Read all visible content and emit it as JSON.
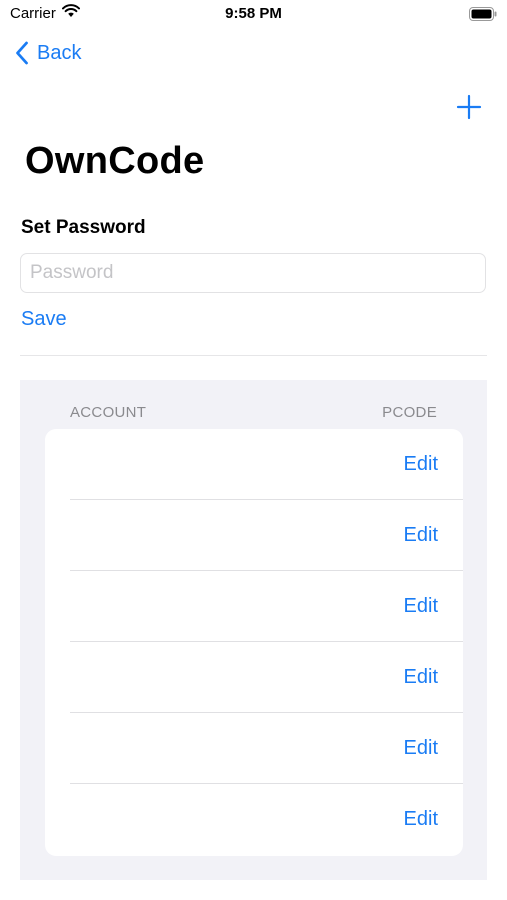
{
  "status_bar": {
    "carrier": "Carrier",
    "time": "9:58 PM"
  },
  "nav": {
    "back_label": "Back"
  },
  "page": {
    "title": "OwnCode"
  },
  "form": {
    "section_label": "Set Password",
    "password_placeholder": "Password",
    "save_label": "Save"
  },
  "table": {
    "headers": {
      "account": "ACCOUNT",
      "pcode": "PCODE"
    },
    "rows": [
      {
        "edit_label": "Edit"
      },
      {
        "edit_label": "Edit"
      },
      {
        "edit_label": "Edit"
      },
      {
        "edit_label": "Edit"
      },
      {
        "edit_label": "Edit"
      },
      {
        "edit_label": "Edit"
      }
    ]
  },
  "colors": {
    "accent": "#1a7cf4",
    "panel_bg": "#f2f2f7"
  }
}
